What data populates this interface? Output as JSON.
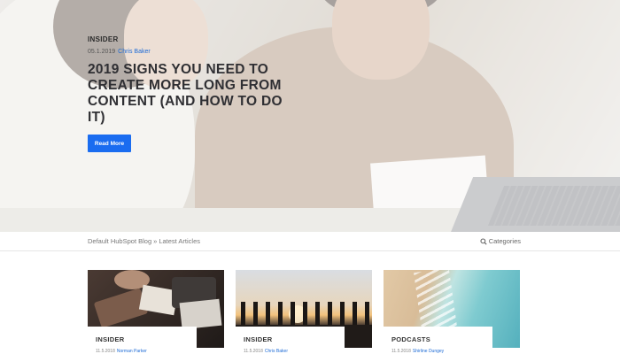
{
  "hero": {
    "topic": "INSIDER",
    "date": "05.1.2019",
    "author": "Chris Baker",
    "title": "2019 SIGNS YOU NEED TO CREATE MORE LONG FROM CONTENT (AND HOW TO DO IT)",
    "read_more_label": "Read More"
  },
  "subbar": {
    "breadcrumb": [
      "Default HubSpot Blog",
      "Latest Articles"
    ],
    "breadcrumb_sep": "»",
    "categories_label": "Categories",
    "categories_icon": "search-icon"
  },
  "cards": [
    {
      "topic": "INSIDER",
      "date": "11.5.2018",
      "author": "Norman Parker"
    },
    {
      "topic": "INSIDER",
      "date": "11.5.2018",
      "author": "Chris Baker"
    },
    {
      "topic": "PODCASTS",
      "date": "11.5.2018",
      "author": "Shirline Dungey"
    }
  ],
  "colors": {
    "accent": "#1a6cf0",
    "link": "#1d6bd6"
  }
}
